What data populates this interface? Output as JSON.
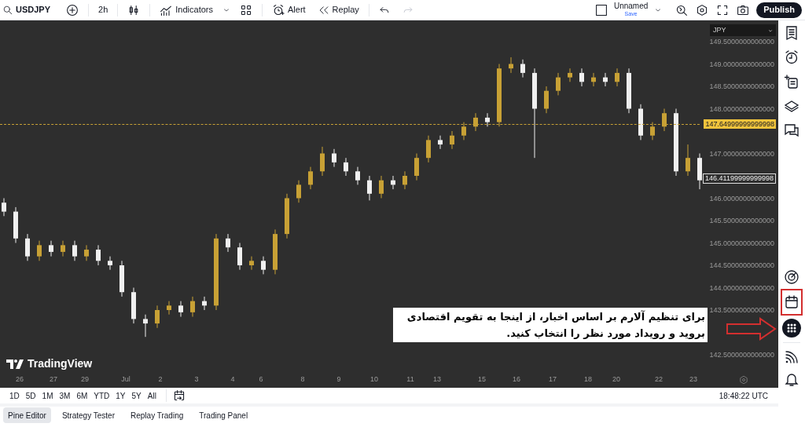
{
  "toolbar": {
    "symbol": "USDJPY",
    "interval": "2h",
    "indicators": "Indicators",
    "alert": "Alert",
    "replay": "Replay",
    "layout_name": "Unnamed",
    "save": "Save",
    "publish": "Publish"
  },
  "chart": {
    "currency": "JPY",
    "chart_data": {
      "type": "candlestick",
      "ohlc": [
        [
          145.9,
          146.0,
          145.6,
          145.7
        ],
        [
          145.7,
          145.8,
          145.0,
          145.1
        ],
        [
          145.1,
          145.2,
          144.6,
          144.7
        ],
        [
          144.7,
          145.05,
          144.6,
          144.95
        ],
        [
          144.95,
          145.05,
          144.7,
          144.8
        ],
        [
          144.8,
          145.05,
          144.7,
          144.95
        ],
        [
          144.95,
          145.05,
          144.6,
          144.7
        ],
        [
          144.7,
          144.95,
          144.6,
          144.85
        ],
        [
          144.85,
          144.95,
          144.5,
          144.6
        ],
        [
          144.6,
          144.7,
          144.4,
          144.5
        ],
        [
          144.5,
          144.6,
          143.8,
          143.9
        ],
        [
          143.9,
          144.0,
          143.2,
          143.3
        ],
        [
          143.3,
          143.4,
          142.9,
          143.2
        ],
        [
          143.2,
          143.6,
          143.1,
          143.5
        ],
        [
          143.5,
          143.7,
          143.4,
          143.6
        ],
        [
          143.6,
          143.7,
          143.35,
          143.45
        ],
        [
          143.45,
          143.8,
          143.35,
          143.7
        ],
        [
          143.7,
          143.8,
          143.5,
          143.6
        ],
        [
          143.6,
          145.2,
          143.5,
          145.1
        ],
        [
          145.1,
          145.2,
          144.8,
          144.9
        ],
        [
          144.9,
          145.0,
          144.4,
          144.5
        ],
        [
          144.5,
          144.7,
          144.4,
          144.6
        ],
        [
          144.6,
          144.7,
          144.3,
          144.4
        ],
        [
          144.4,
          145.3,
          144.3,
          145.2
        ],
        [
          145.2,
          146.1,
          145.1,
          146.0
        ],
        [
          146.0,
          146.4,
          145.9,
          146.3
        ],
        [
          146.3,
          146.7,
          146.2,
          146.6
        ],
        [
          146.6,
          147.15,
          146.5,
          147.0
        ],
        [
          147.0,
          147.1,
          146.7,
          146.8
        ],
        [
          146.8,
          146.9,
          146.5,
          146.6
        ],
        [
          146.6,
          146.7,
          146.3,
          146.4
        ],
        [
          146.4,
          146.5,
          145.95,
          146.1
        ],
        [
          146.1,
          146.5,
          146.0,
          146.4
        ],
        [
          146.4,
          146.5,
          146.2,
          146.3
        ],
        [
          146.3,
          146.6,
          146.2,
          146.5
        ],
        [
          146.5,
          147.0,
          146.4,
          146.9
        ],
        [
          146.9,
          147.4,
          146.8,
          147.3
        ],
        [
          147.3,
          147.4,
          147.1,
          147.2
        ],
        [
          147.2,
          147.5,
          147.1,
          147.4
        ],
        [
          147.4,
          147.7,
          147.3,
          147.6
        ],
        [
          147.6,
          147.9,
          147.5,
          147.8
        ],
        [
          147.8,
          147.9,
          147.6,
          147.7
        ],
        [
          147.7,
          149.0,
          147.6,
          148.9
        ],
        [
          148.9,
          149.15,
          148.8,
          149.0
        ],
        [
          149.0,
          149.1,
          148.7,
          148.8
        ],
        [
          148.8,
          148.9,
          146.9,
          148.0
        ],
        [
          148.0,
          148.5,
          147.9,
          148.4
        ],
        [
          148.4,
          148.8,
          148.3,
          148.7
        ],
        [
          148.7,
          148.9,
          148.6,
          148.8
        ],
        [
          148.8,
          148.9,
          148.5,
          148.6
        ],
        [
          148.6,
          148.8,
          148.5,
          148.7
        ],
        [
          148.7,
          148.8,
          148.5,
          148.6
        ],
        [
          148.6,
          148.9,
          148.5,
          148.8
        ],
        [
          148.8,
          148.9,
          147.9,
          148.0
        ],
        [
          148.0,
          148.1,
          147.3,
          147.4
        ],
        [
          147.4,
          147.7,
          147.3,
          147.6
        ],
        [
          147.6,
          148.0,
          147.5,
          147.9
        ],
        [
          147.9,
          148.0,
          146.5,
          146.6
        ],
        [
          146.6,
          147.2,
          146.5,
          146.9
        ],
        [
          146.9,
          147.0,
          146.2,
          146.4
        ]
      ],
      "yticks": [
        {
          "value": 149.5,
          "label": "149.5000000000000"
        },
        {
          "value": 149.0,
          "label": "149.0000000000000"
        },
        {
          "value": 148.5,
          "label": "148.5000000000000"
        },
        {
          "value": 148.0,
          "label": "148.0000000000000"
        },
        {
          "value": 147.0,
          "label": "147.0000000000000"
        },
        {
          "value": 146.0,
          "label": "146.0000000000000"
        },
        {
          "value": 145.5,
          "label": "145.5000000000000"
        },
        {
          "value": 145.0,
          "label": "145.0000000000000"
        },
        {
          "value": 144.5,
          "label": "144.5000000000000"
        },
        {
          "value": 144.0,
          "label": "144.0000000000000"
        },
        {
          "value": 143.5,
          "label": "143.5000000000000"
        },
        {
          "value": 142.5,
          "label": "142.5000000000000"
        }
      ],
      "ylim": [
        142.5,
        149.5
      ]
    },
    "price_line_label": "147.64999999999998",
    "time_axis": [
      "26",
      "27",
      "29",
      "Jul",
      "2",
      "3",
      "4",
      "6",
      "8",
      "9",
      "10",
      "11",
      "13",
      "15",
      "16",
      "17",
      "18",
      "20",
      "22",
      "23"
    ],
    "last_price_label": "146.41199999999998",
    "brand": "TradingView"
  },
  "callout": {
    "text": "برای تنظیم آلارم بر اساس اخبار، از اینجا به تقویم اقتصادی بروید و رویداد مورد نظر را انتخاب کنید."
  },
  "ranges": [
    "1D",
    "5D",
    "1M",
    "3M",
    "6M",
    "YTD",
    "1Y",
    "5Y",
    "All"
  ],
  "clock": "18:48:22 UTC",
  "panel_tabs": [
    {
      "label": "Pine Editor",
      "selected": true
    },
    {
      "label": "Strategy Tester",
      "selected": false
    },
    {
      "label": "Replay Trading",
      "selected": false
    },
    {
      "label": "Trading Panel",
      "selected": false
    }
  ]
}
